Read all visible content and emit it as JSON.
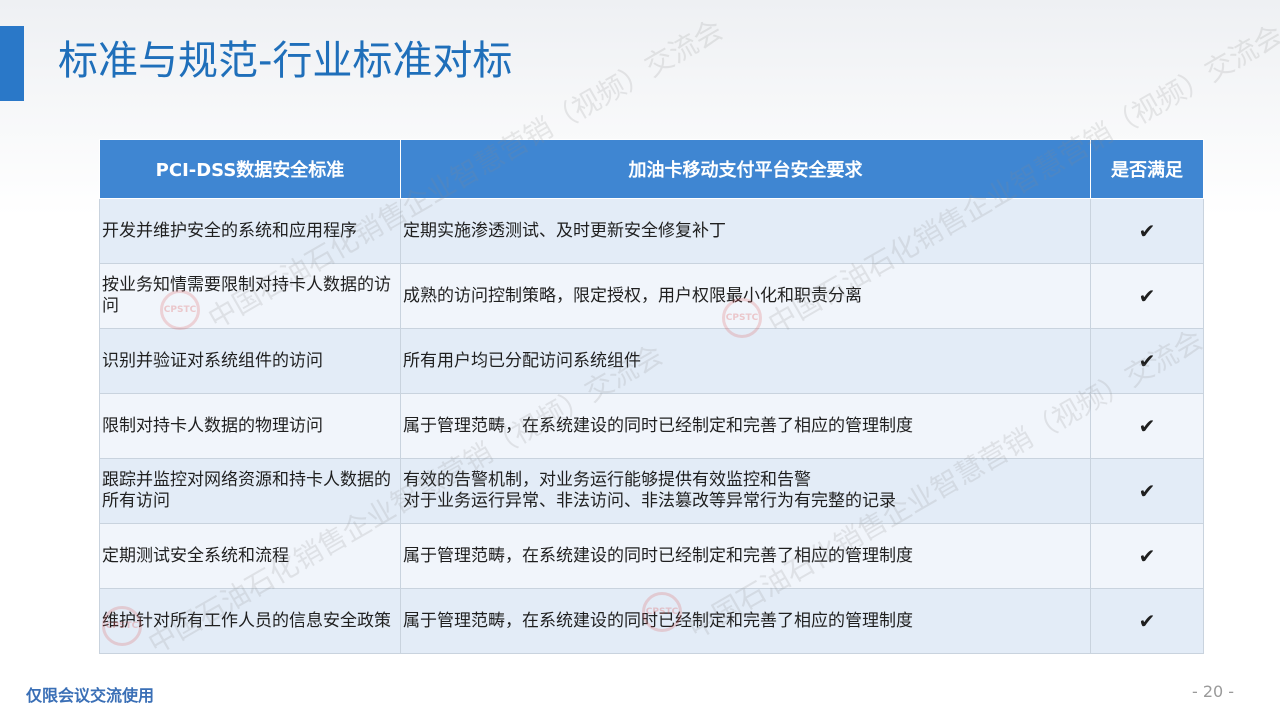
{
  "slide": {
    "title": "标准与规范-行业标准对标",
    "footer_note": "仅限会议交流使用",
    "page_number": "- 20 -",
    "accent_color": "#2a78c8",
    "header_color": "#3f86d2"
  },
  "watermark": {
    "text": "中国石油石化销售企业智慧营销（视频）交流会",
    "logo_text": "CPSTC"
  },
  "table": {
    "headers": [
      "PCI-DSS数据安全标准",
      "加油卡移动支付平台安全要求",
      "是否满足"
    ],
    "rows": [
      {
        "standard": "开发并维护安全的系统和应用程序",
        "requirement": "定期实施渗透测试、及时更新安全修复补丁",
        "met": "✔"
      },
      {
        "standard": "按业务知情需要限制对持卡人数据的访问",
        "requirement": "成熟的访问控制策略，限定授权，用户权限最小化和职责分离",
        "met": "✔"
      },
      {
        "standard": "识别并验证对系统组件的访问",
        "requirement": "所有用户均已分配访问系统组件",
        "met": "✔"
      },
      {
        "standard": "限制对持卡人数据的物理访问",
        "requirement": "属于管理范畴，在系统建设的同时已经制定和完善了相应的管理制度",
        "met": "✔"
      },
      {
        "standard": "跟踪并监控对网络资源和持卡人数据的所有访问",
        "requirement": "有效的告警机制，对业务运行能够提供有效监控和告警\n对于业务运行异常、非法访问、非法篡改等异常行为有完整的记录",
        "met": "✔"
      },
      {
        "standard": "定期测试安全系统和流程",
        "requirement": "属于管理范畴，在系统建设的同时已经制定和完善了相应的管理制度",
        "met": "✔"
      },
      {
        "standard": "维护针对所有工作人员的信息安全政策",
        "requirement": "属于管理范畴，在系统建设的同时已经制定和完善了相应的管理制度",
        "met": "✔"
      }
    ]
  }
}
